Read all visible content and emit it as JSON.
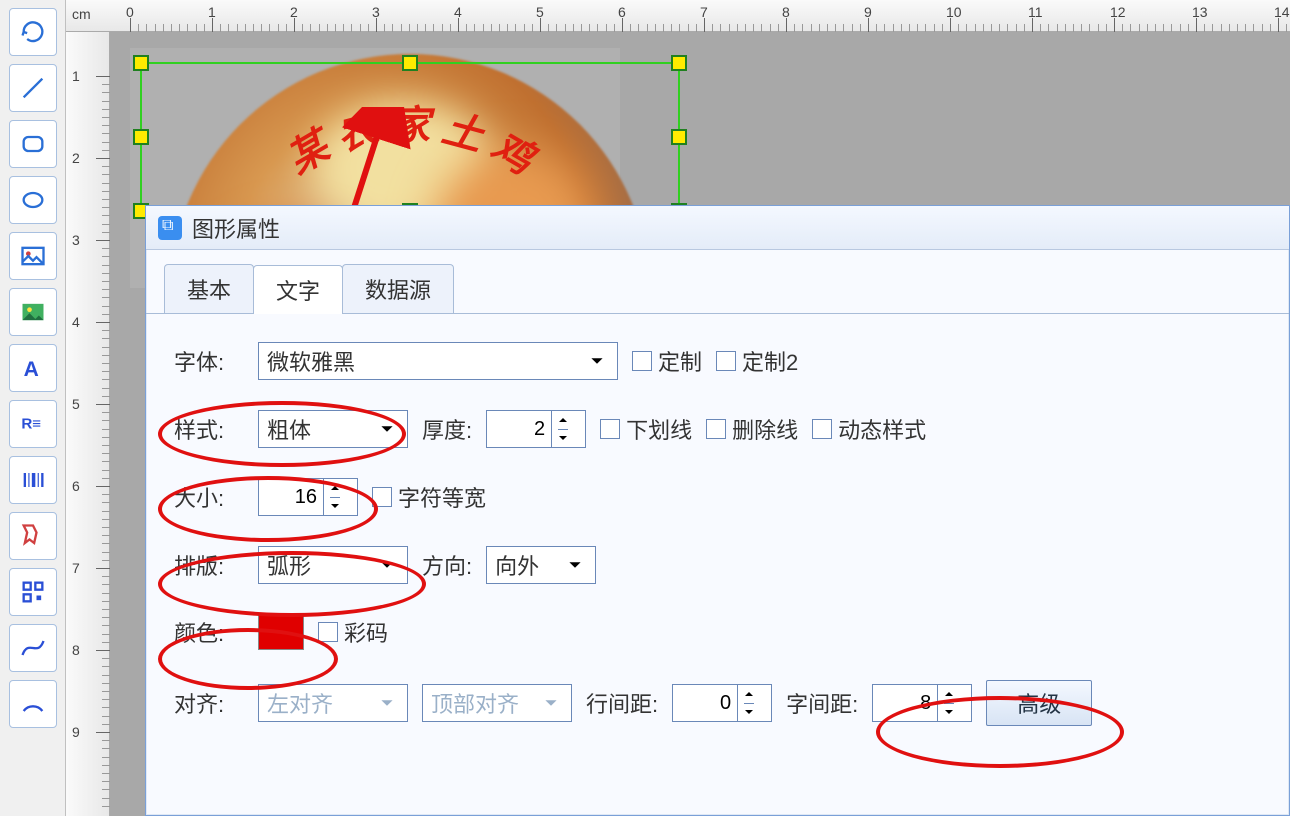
{
  "ruler": {
    "unit": "cm",
    "h_ticks": [
      0,
      1,
      2,
      3,
      4,
      5,
      6,
      7,
      8,
      9,
      10,
      11,
      12,
      13,
      14
    ],
    "v_ticks": [
      1,
      2,
      3,
      4,
      5,
      6,
      7,
      8,
      9
    ]
  },
  "canvas": {
    "arc_chars": [
      "某",
      "农",
      "家",
      "土",
      "鸡"
    ]
  },
  "dialog": {
    "title": "图形属性",
    "tabs": {
      "basic": "基本",
      "text": "文字",
      "datasource": "数据源"
    },
    "font": {
      "label": "字体:",
      "value": "微软雅黑",
      "custom1": "定制",
      "custom2": "定制2"
    },
    "style": {
      "label": "样式:",
      "value": "粗体",
      "thickness_label": "厚度:",
      "thickness": "2",
      "underline": "下划线",
      "strike": "删除线",
      "dyn": "动态样式"
    },
    "size": {
      "label": "大小:",
      "value": "16",
      "mono": "字符等宽"
    },
    "layout": {
      "label": "排版:",
      "value": "弧形",
      "dir_label": "方向:",
      "dir_value": "向外"
    },
    "color": {
      "label": "颜色:",
      "hex": "#e00000",
      "code": "彩码"
    },
    "align": {
      "label": "对齐:",
      "h": "左对齐",
      "v": "顶部对齐",
      "line_label": "行间距:",
      "line": "0",
      "char_label": "字间距:",
      "char": "8",
      "advanced": "高级"
    }
  }
}
